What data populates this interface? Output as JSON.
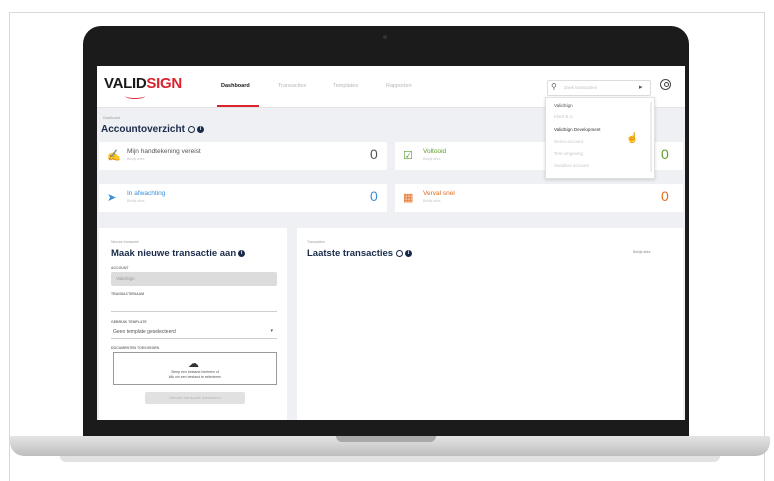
{
  "app": {
    "brand_part1": "VALID",
    "brand_part2": "SIGN",
    "colors": {
      "brand_red": "#d9232d",
      "navy": "#1a2b4a",
      "green": "#5aa02c",
      "orange": "#e06b1f",
      "blue": "#3a8ed8"
    }
  },
  "nav": {
    "items": [
      {
        "label": "Dashboard",
        "active": true
      },
      {
        "label": "Transacties",
        "active": false
      },
      {
        "label": "Templates",
        "active": false
      },
      {
        "label": "Rapporten",
        "active": false
      }
    ]
  },
  "search": {
    "placeholder": "Zoek transacties"
  },
  "org_dropdown": {
    "items": [
      {
        "label": "ValidSign",
        "style": "strong"
      },
      {
        "label": "Klant B.V.",
        "style": "faint"
      },
      {
        "label": "ValidSign Development",
        "style": "hl"
      },
      {
        "label": "Demo account",
        "style": "faint"
      },
      {
        "label": "Test omgeving",
        "style": "faint"
      },
      {
        "label": "Sandbox account",
        "style": "faint"
      }
    ]
  },
  "overview": {
    "breadcrumb": "Dashboard",
    "title": "Accountoverzicht",
    "cards": [
      {
        "label": "Mijn handtekening vereist",
        "sublabel": "Bekijk alles",
        "count": "0",
        "icon": "signature-icon"
      },
      {
        "label": "Voltooid",
        "sublabel": "Bekijk alles",
        "count": "0",
        "icon": "check-icon"
      },
      {
        "label": "In afwachting",
        "sublabel": "Bekijk alles",
        "count": "0",
        "icon": "send-icon"
      },
      {
        "label": "Verval snel",
        "sublabel": "Bekijk alles",
        "count": "0",
        "icon": "calendar-icon"
      }
    ]
  },
  "new_transaction": {
    "breadcrumb": "Nieuwe transactie",
    "title": "Maak nieuwe transactie aan",
    "fields": {
      "account_label": "ACCOUNT",
      "account_value": "ValidSign",
      "name_label": "TRANSACTIENAAM",
      "template_label": "GEBRUIK TEMPLATE",
      "template_value": "Geen template geselecteerd",
      "docs_label": "DOCUMENTEN TOEVOEGEN"
    },
    "upload_line1": "Sleep een bestand hierheen of",
    "upload_line2": "klik om een bestand te selecteren",
    "submit_label": "Nieuwe transactie aanmaken"
  },
  "recent": {
    "breadcrumb": "Transacties",
    "title": "Laatste transacties",
    "view_all": "Bekijk alles"
  }
}
